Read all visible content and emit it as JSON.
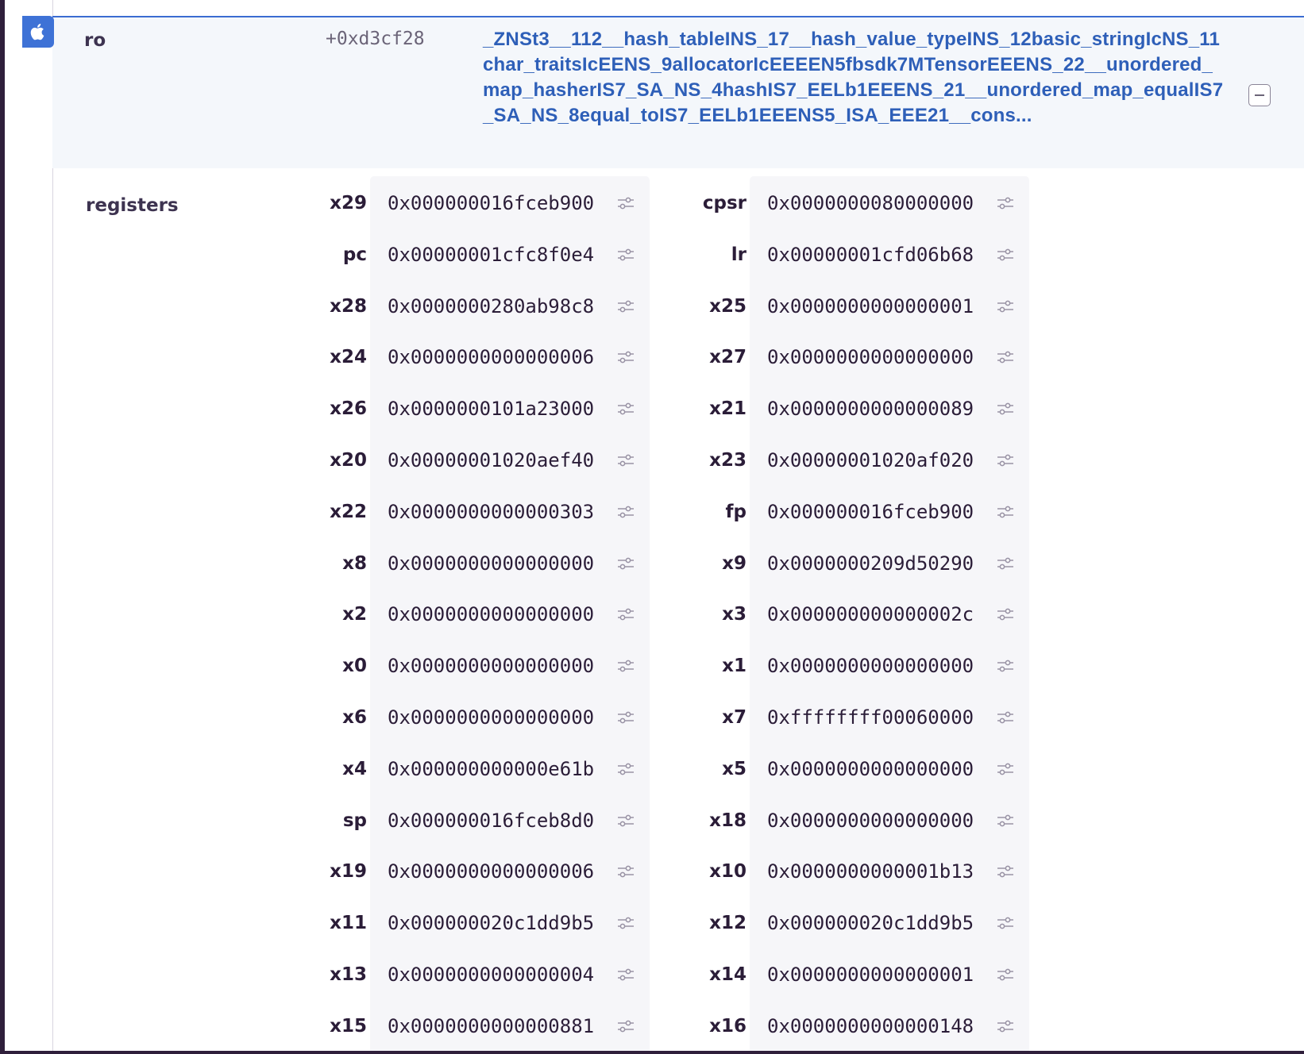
{
  "frame": {
    "package": "ro",
    "address": "+0xd3cf28",
    "function": "_ZNSt3__112__hash_tableINS_17__hash_value_typeINS_12basic_stringIcNS_11char_traitsIcEENS_9allocatorIcEEEEN5fbsdk7MTensorEEENS_22__unordered_map_hasherIS7_SA_NS_4hashIS7_EELb1EEENS_21__unordered_map_equalIS7_SA_NS_8equal_toIS7_EELb1EEENS5_ISA_EEE21__cons..."
  },
  "icons": {
    "platform": "apple-icon",
    "collapse": "collapse-icon",
    "register_action": "sliders-icon"
  },
  "registers": {
    "title": "registers",
    "left": [
      {
        "name": "x29",
        "value": "0x000000016fceb900"
      },
      {
        "name": "pc",
        "value": "0x00000001cfc8f0e4"
      },
      {
        "name": "x28",
        "value": "0x0000000280ab98c8"
      },
      {
        "name": "x24",
        "value": "0x0000000000000006"
      },
      {
        "name": "x26",
        "value": "0x0000000101a23000"
      },
      {
        "name": "x20",
        "value": "0x00000001020aef40"
      },
      {
        "name": "x22",
        "value": "0x0000000000000303"
      },
      {
        "name": "x8",
        "value": "0x0000000000000000"
      },
      {
        "name": "x2",
        "value": "0x0000000000000000"
      },
      {
        "name": "x0",
        "value": "0x0000000000000000"
      },
      {
        "name": "x6",
        "value": "0x0000000000000000"
      },
      {
        "name": "x4",
        "value": "0x000000000000e61b"
      },
      {
        "name": "sp",
        "value": "0x000000016fceb8d0"
      },
      {
        "name": "x19",
        "value": "0x0000000000000006"
      },
      {
        "name": "x11",
        "value": "0x000000020c1dd9b5"
      },
      {
        "name": "x13",
        "value": "0x0000000000000004"
      },
      {
        "name": "x15",
        "value": "0x0000000000000881"
      }
    ],
    "right": [
      {
        "name": "cpsr",
        "value": "0x0000000080000000"
      },
      {
        "name": "lr",
        "value": "0x00000001cfd06b68"
      },
      {
        "name": "x25",
        "value": "0x0000000000000001"
      },
      {
        "name": "x27",
        "value": "0x0000000000000000"
      },
      {
        "name": "x21",
        "value": "0x0000000000000089"
      },
      {
        "name": "x23",
        "value": "0x00000001020af020"
      },
      {
        "name": "fp",
        "value": "0x000000016fceb900"
      },
      {
        "name": "x9",
        "value": "0x0000000209d50290"
      },
      {
        "name": "x3",
        "value": "0x000000000000002c"
      },
      {
        "name": "x1",
        "value": "0x0000000000000000"
      },
      {
        "name": "x7",
        "value": "0xffffffff00060000"
      },
      {
        "name": "x5",
        "value": "0x0000000000000000"
      },
      {
        "name": "x18",
        "value": "0x0000000000000000"
      },
      {
        "name": "x10",
        "value": "0x0000000000001b13"
      },
      {
        "name": "x12",
        "value": "0x000000020c1dd9b5"
      },
      {
        "name": "x14",
        "value": "0x0000000000000001"
      },
      {
        "name": "x16",
        "value": "0x0000000000000148"
      }
    ]
  }
}
